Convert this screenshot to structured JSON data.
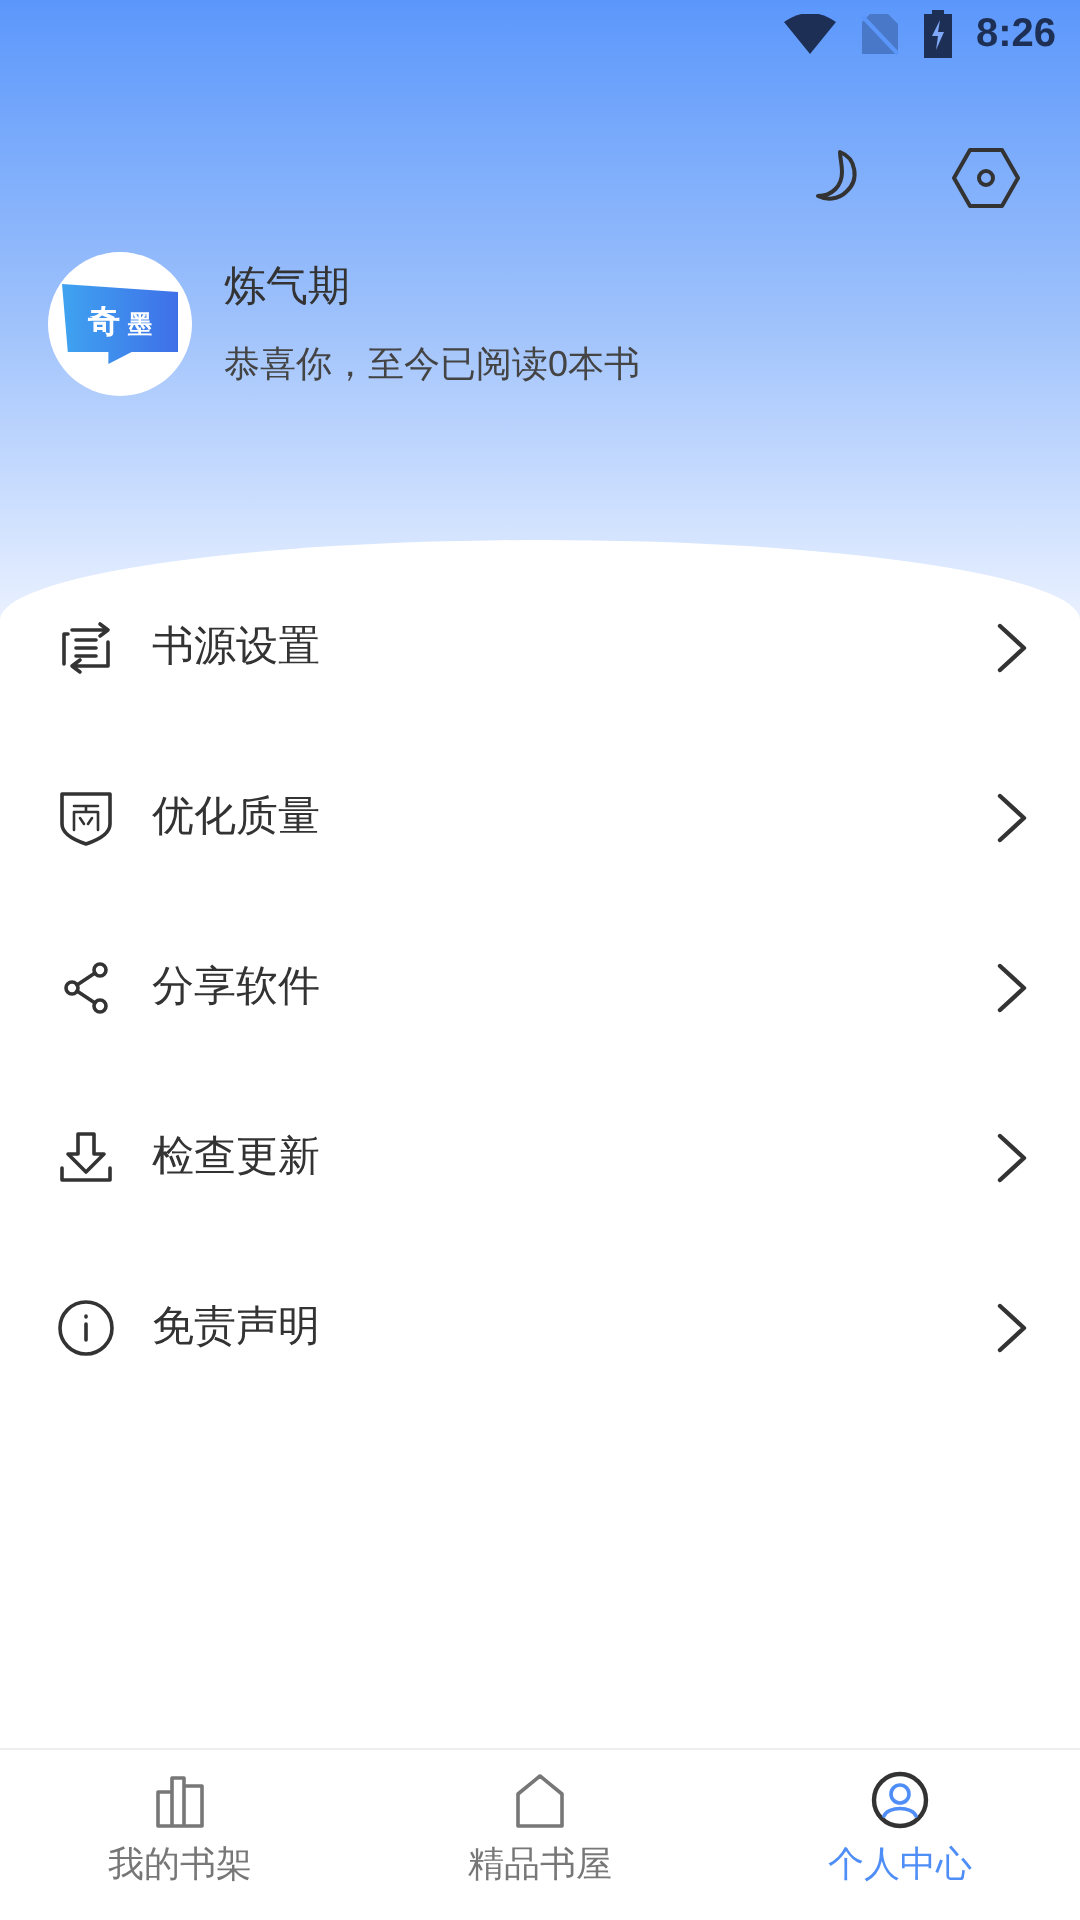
{
  "status_bar": {
    "time": "8:26"
  },
  "profile": {
    "logo_text": [
      "奇",
      "墨"
    ],
    "level": "炼气期",
    "summary": "恭喜你，至今已阅读0本书"
  },
  "menu": [
    {
      "kind": "source",
      "label": "书源设置"
    },
    {
      "kind": "quality",
      "label": "优化质量"
    },
    {
      "kind": "share",
      "label": "分享软件"
    },
    {
      "kind": "update",
      "label": "检查更新"
    },
    {
      "kind": "info",
      "label": "免责声明"
    }
  ],
  "tabs": [
    {
      "kind": "shelf",
      "label": "我的书架",
      "selected": false
    },
    {
      "kind": "home",
      "label": "精品书屋",
      "selected": false
    },
    {
      "kind": "user",
      "label": "个人中心",
      "selected": true
    }
  ]
}
